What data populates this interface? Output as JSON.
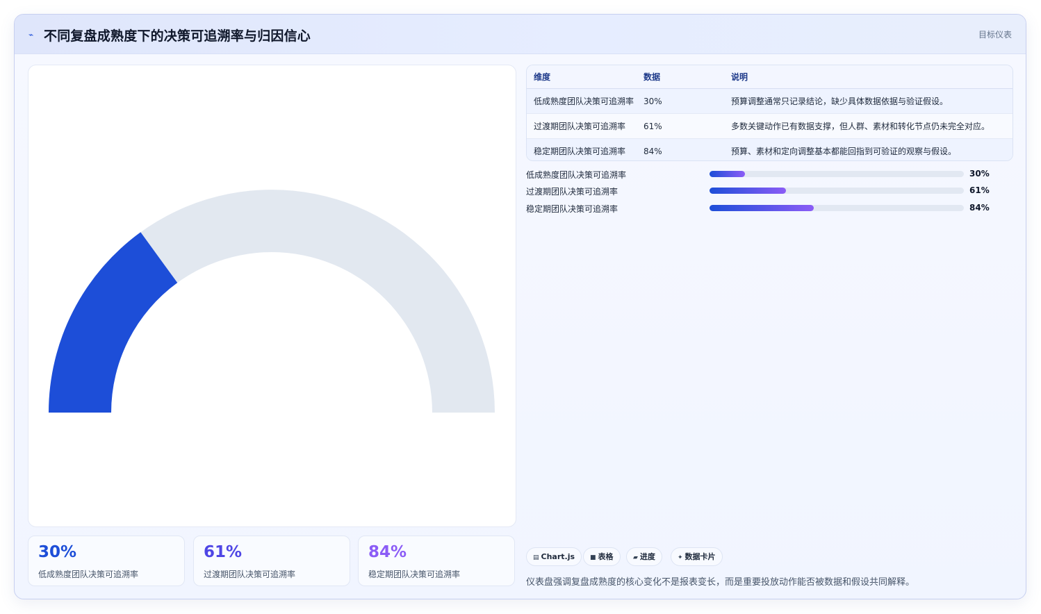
{
  "header": {
    "icon": "pulse-icon",
    "title": "不同复盘成熟度下的决策可追溯率与归因信心",
    "tag": "目标仪表"
  },
  "colors": {
    "accent": "#1d4ed8",
    "track": "#e2e8f0",
    "gradient_end": "#8b5cf6",
    "kpi": [
      "#1d4ed8",
      "#4f46e5",
      "#8b5cf6"
    ]
  },
  "chart_data": {
    "type": "gauge",
    "value": 30,
    "max": 100,
    "unit": "%",
    "label": "低成熟度团队决策可追溯率"
  },
  "table": {
    "headers": [
      "维度",
      "数据",
      "说明"
    ],
    "rows": [
      {
        "dim": "低成熟度团队决策可追溯率",
        "value": "30%",
        "note": "预算调整通常只记录结论，缺少具体数据依据与验证假设。"
      },
      {
        "dim": "过渡期团队决策可追溯率",
        "value": "61%",
        "note": "多数关键动作已有数据支撑，但人群、素材和转化节点仍未完全对应。"
      },
      {
        "dim": "稳定期团队决策可追溯率",
        "value": "84%",
        "note": "预算、素材和定向调整基本都能回指到可验证的观察与假设。"
      }
    ]
  },
  "progress": [
    {
      "label": "低成熟度团队决策可追溯率",
      "value_text": "30%",
      "fraction": 0.14
    },
    {
      "label": "过渡期团队决策可追溯率",
      "value_text": "61%",
      "fraction": 0.3
    },
    {
      "label": "稳定期团队决策可追溯率",
      "value_text": "84%",
      "fraction": 0.41
    }
  ],
  "kpis": [
    {
      "value": "30%",
      "label": "低成熟度团队决策可追溯率"
    },
    {
      "value": "61%",
      "label": "过渡期团队决策可追溯率"
    },
    {
      "value": "84%",
      "label": "稳定期团队决策可追溯率"
    }
  ],
  "chips": [
    {
      "icon": "chart-icon",
      "glyph": "▤",
      "label": "Chart.js"
    },
    {
      "icon": "table-icon",
      "glyph": "■",
      "label": "表格"
    },
    {
      "icon": "progress-icon",
      "glyph": "▰",
      "label": "进度"
    },
    {
      "icon": "card-icon",
      "glyph": "✦",
      "label": "数据卡片"
    }
  ],
  "footer_note": "仪表盘强调复盘成熟度的核心变化不是报表变长，而是重要投放动作能否被数据和假设共同解释。"
}
